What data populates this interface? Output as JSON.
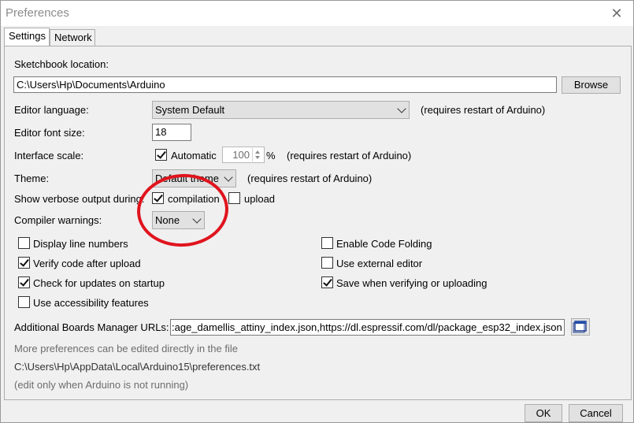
{
  "window": {
    "title": "Preferences",
    "close_glyph": "✕"
  },
  "tabs": [
    {
      "label": "Settings",
      "active": true
    },
    {
      "label": "Network",
      "active": false
    }
  ],
  "sketchbook": {
    "label": "Sketchbook location:",
    "value": "C:\\Users\\Hp\\Documents\\Arduino",
    "browse_label": "Browse"
  },
  "editor_language": {
    "label": "Editor language:",
    "value": "System Default",
    "note": "(requires restart of Arduino)"
  },
  "editor_font_size": {
    "label": "Editor font size:",
    "value": "18"
  },
  "interface_scale": {
    "label": "Interface scale:",
    "automatic_label": "Automatic",
    "automatic_checked": true,
    "value": "100",
    "unit": "%",
    "note": "(requires restart of Arduino)"
  },
  "theme": {
    "label": "Theme:",
    "value": "Default theme",
    "note": "(requires restart of Arduino)"
  },
  "verbose": {
    "label": "Show verbose output during:",
    "compilation_label": "compilation",
    "compilation_checked": true,
    "upload_label": "upload",
    "upload_checked": false
  },
  "compiler_warnings": {
    "label": "Compiler warnings:",
    "value": "None"
  },
  "options_left": [
    {
      "label": "Display line numbers",
      "checked": false
    },
    {
      "label": "Verify code after upload",
      "checked": true
    },
    {
      "label": "Check for updates on startup",
      "checked": true
    },
    {
      "label": "Use accessibility features",
      "checked": false
    }
  ],
  "options_right": [
    {
      "label": "Enable Code Folding",
      "checked": false
    },
    {
      "label": "Use external editor",
      "checked": false
    },
    {
      "label": "Save when verifying or uploading",
      "checked": true
    }
  ],
  "boards_manager": {
    "label": "Additional Boards Manager URLs:",
    "value": ":age_damellis_attiny_index.json,https://dl.espressif.com/dl/package_esp32_index.json"
  },
  "footer_info": {
    "more_prefs": "More preferences can be edited directly in the file",
    "prefs_path": "C:\\Users\\Hp\\AppData\\Local\\Arduino15\\preferences.txt",
    "edit_note": "(edit only when Arduino is not running)"
  },
  "buttons": {
    "ok_label": "OK",
    "cancel_label": "Cancel"
  },
  "colors": {
    "annotation_circle": "#e0141e"
  },
  "icons": {
    "boards_url_editor": "window-list-icon",
    "close": "close-icon"
  }
}
